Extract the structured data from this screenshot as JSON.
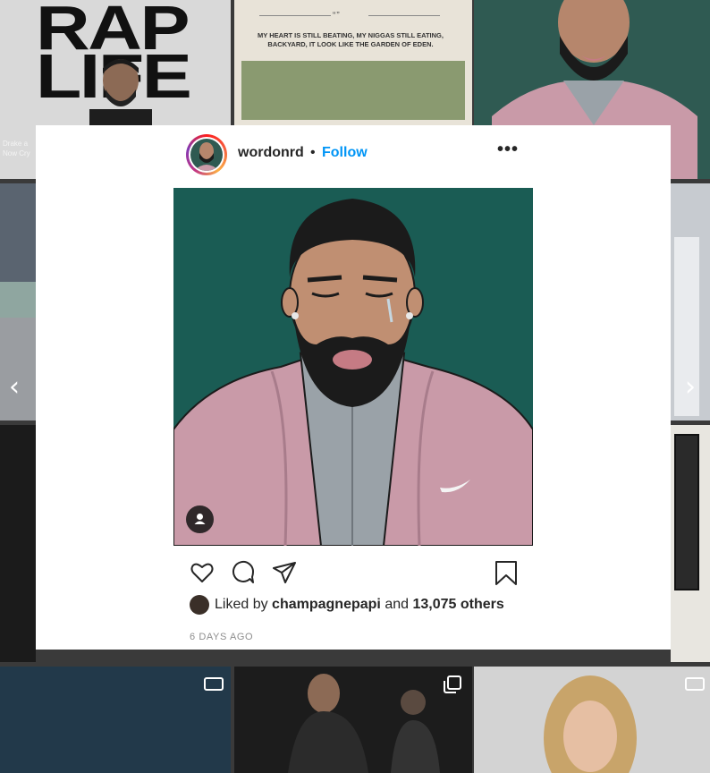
{
  "background": {
    "tile1_title": "RAP\nLIFE",
    "tile1_caption": "Drake a\nNow Cry",
    "tile2_quote_mark": "“”",
    "tile2_quote": "MY HEART IS STILL BEATING, MY NIGGAS STILL EATING, BACKYARD, IT LOOK LIKE THE GARDEN OF EDEN."
  },
  "post": {
    "username": "wordonrd",
    "separator": "•",
    "follow_label": "Follow",
    "more_label": "•••",
    "liked_by_prefix": "Liked by",
    "liked_by_user": "champagnepapi",
    "liked_by_and": "and",
    "liked_by_others": "13,075 others",
    "timestamp": "6 DAYS AGO"
  },
  "navigation": {
    "prev_label": "‹",
    "next_label": "›"
  },
  "icons": [
    "heart-icon",
    "comment-icon",
    "share-icon",
    "bookmark-icon",
    "user-tag-icon",
    "camera-icon",
    "multi-image-icon"
  ],
  "colors": {
    "follow_blue": "#0095f6",
    "text_primary": "#262626",
    "text_secondary": "#8e8e8e",
    "artwork_background": "#1a5c54"
  }
}
